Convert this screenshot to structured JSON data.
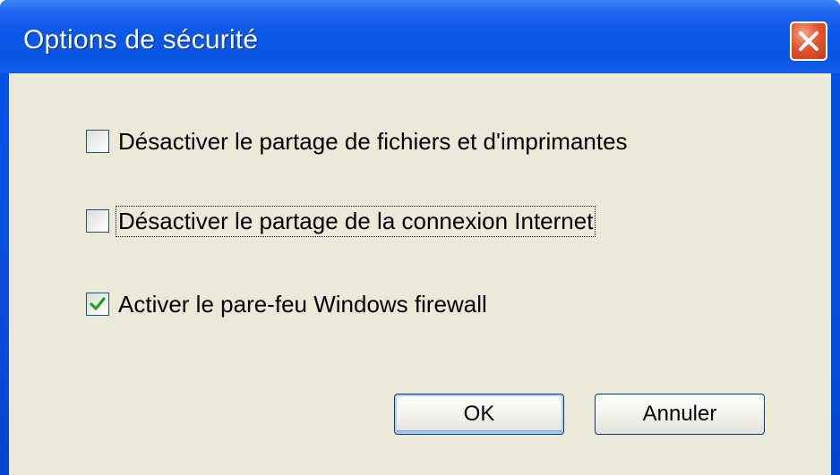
{
  "window": {
    "title": "Options de sécurité",
    "close_icon": "close-icon"
  },
  "options": [
    {
      "label": "Désactiver le partage de fichiers et d'imprimantes",
      "checked": false
    },
    {
      "label": "Désactiver le partage de la connexion Internet",
      "checked": false,
      "focused": true
    },
    {
      "label": "Activer le pare-feu Windows firewall",
      "checked": true
    }
  ],
  "buttons": {
    "ok_label": "OK",
    "cancel_label": "Annuler"
  },
  "colors": {
    "titlebar": "#0a54e2",
    "client": "#ece9d8",
    "check_mark": "#21a121",
    "close_button": "#e3552f"
  }
}
